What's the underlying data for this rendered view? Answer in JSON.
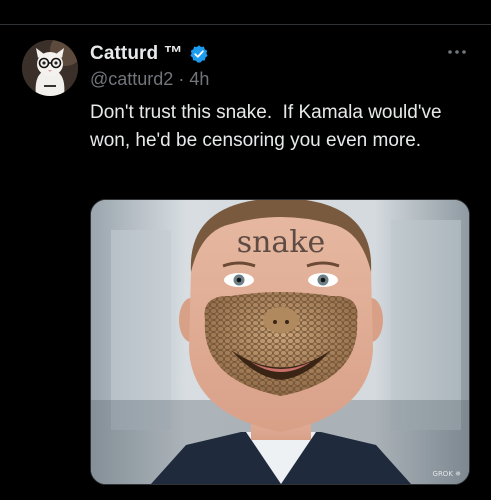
{
  "header_actions": [
    {
      "icon": "reply-icon"
    },
    {
      "icon": "retweet-icon"
    },
    {
      "icon": "like-icon"
    },
    {
      "icon": "views-icon"
    },
    {
      "icon": "share-icon"
    }
  ],
  "tweet": {
    "author": {
      "display_name": "Catturd ™",
      "handle": "@catturd2",
      "separator": "·",
      "time": "4h",
      "verified": true
    },
    "text": "Don't trust this snake.  If Kamala would've won, he'd be censoring you even more.",
    "media": {
      "forehead_text": "snake",
      "watermark": "GROK ✵"
    }
  },
  "colors": {
    "background": "#000000",
    "text": "#e7e9ea",
    "secondary_text": "#71767b",
    "verified_blue": "#1d9bf0",
    "divider": "#2f3336"
  }
}
